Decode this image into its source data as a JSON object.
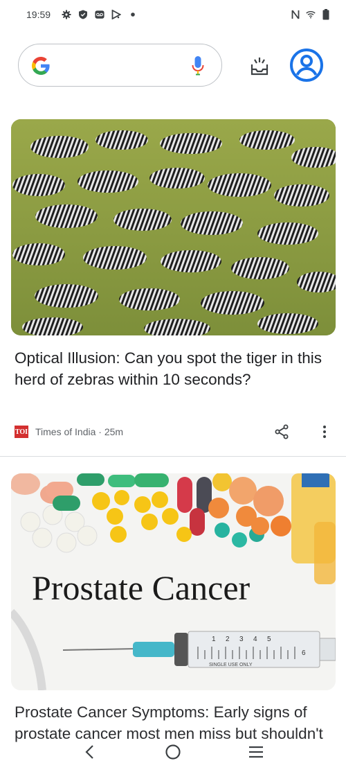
{
  "status_bar": {
    "time": "19:59"
  },
  "search": {
    "placeholder": ""
  },
  "cards": [
    {
      "headline": "Optical Illusion: Can you spot the tiger in this herd of zebras within 10 seconds?",
      "source_logo": "TOI",
      "source": "Times of India",
      "age": "25m",
      "image_icon": "zebra-herd-image"
    },
    {
      "image_text": "Prostate Cancer",
      "syringe_label": "SINGLE USE ONLY",
      "syringe_numbers": [
        "1",
        "2",
        "3",
        "4",
        "5",
        "6"
      ],
      "headline": "Prostate Cancer Symptoms: Early signs of prostate cancer most men miss but shouldn't",
      "image_icon": "pills-syringe-image"
    }
  ],
  "colors": {
    "accent": "#1a73e8",
    "text": "#202124",
    "secondary_text": "#5f6368",
    "source_red": "#d32f2f"
  }
}
